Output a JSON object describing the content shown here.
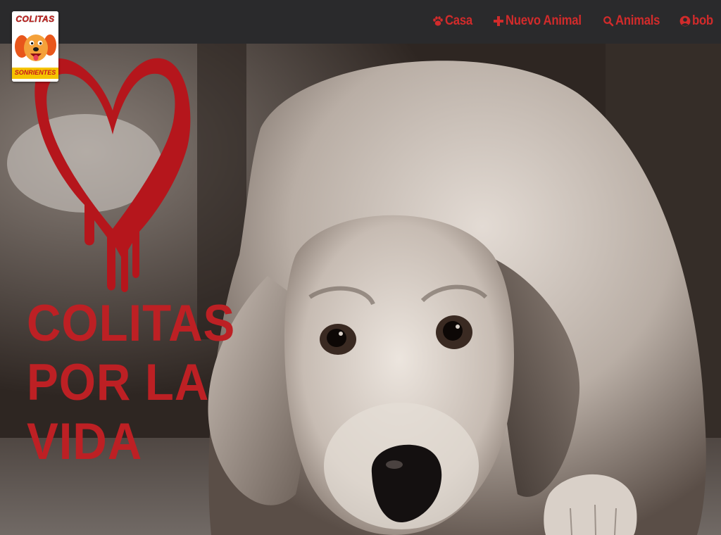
{
  "brand": {
    "logo_line1": "COLITAS",
    "logo_line2": "SONRIENTES",
    "accent_color": "#d12b2b",
    "navbar_color": "#2a2a2c"
  },
  "nav": {
    "items": [
      {
        "label": "Casa",
        "icon": "paw-icon"
      },
      {
        "label": "Nuevo Animal",
        "icon": "plus-icon"
      },
      {
        "label": "Animals",
        "icon": "search-icon"
      },
      {
        "label": "bob",
        "icon": "user-icon"
      }
    ]
  },
  "hero": {
    "title_lines": [
      "COLITAS",
      "POR LA",
      "VIDA"
    ],
    "title_color": "#bd2024",
    "image": "sad-dog-photo",
    "emblem": "bleeding-heart-icon"
  }
}
